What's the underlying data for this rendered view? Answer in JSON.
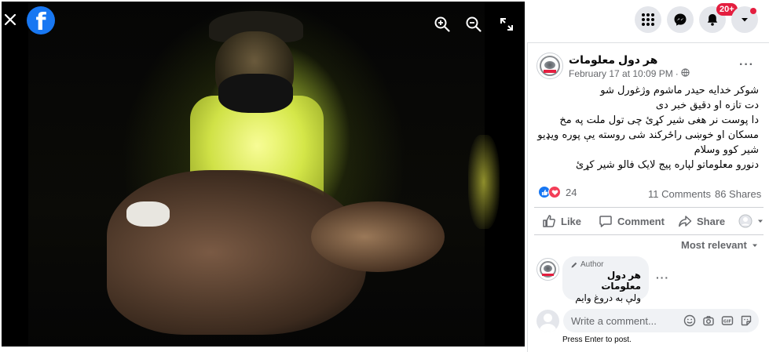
{
  "viewer": {
    "close_icon": "close-icon",
    "logo_letter": "f",
    "tools": [
      "zoom-in-icon",
      "zoom-out-icon",
      "fullscreen-icon"
    ]
  },
  "topnav": {
    "menu_icon": "grid-menu-icon",
    "messenger_icon": "messenger-icon",
    "notifications_icon": "bell-icon",
    "notifications_badge": "20+",
    "account_icon": "caret-down-icon"
  },
  "post": {
    "author": "هر دول معلومات",
    "date": "February 17 at 10:09 PM",
    "separator": "·",
    "privacy_icon": "globe-icon",
    "more": "···",
    "text_lines": [
      "شوکر خدایه حیدر ماشوم وژغورل شو",
      "دت تازه او دقیق خبر دی",
      "دا پوست نر هغی شیر کړئ چی تول ملت په مخ",
      "مسکان او خوښی راځرکند شی روسته یې پوره ویډیو",
      "شیر کوو وسلام",
      "دنورو معلوماتو لپاره پیج لایک فالو شیر کړئ"
    ],
    "reactions": {
      "count": "24",
      "types": [
        "like",
        "love"
      ]
    },
    "comments_count": "11 Comments",
    "shares_count": "86 Shares",
    "actions": {
      "like": "Like",
      "comment": "Comment",
      "share": "Share"
    },
    "sort_label": "Most relevant"
  },
  "comment": {
    "badge": "Author",
    "author": "هر دول معلومات",
    "text": "ولې به دروغ وایم",
    "more": "···"
  },
  "composer": {
    "placeholder": "Write a comment...",
    "hint": "Press Enter to post.",
    "icons": [
      "emoji-icon",
      "camera-icon",
      "gif-icon",
      "sticker-icon"
    ]
  },
  "colors": {
    "accent": "#1877f2",
    "badge": "#e41e3f",
    "text": "#050505",
    "muted": "#65676b"
  }
}
